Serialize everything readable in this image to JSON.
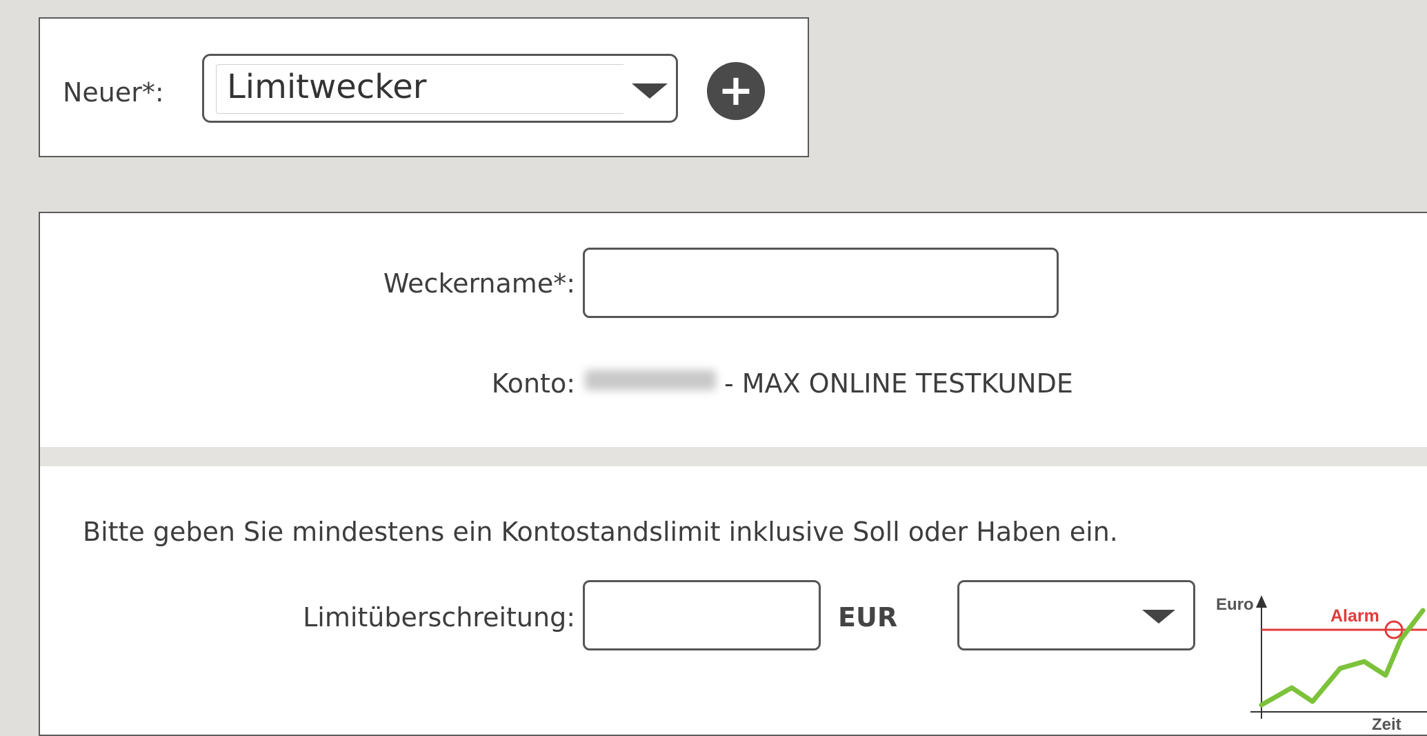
{
  "new_panel": {
    "label": "Neuer*:",
    "select_value": "Limitwecker",
    "add_icon": "plus-circle-icon"
  },
  "form": {
    "name_label": "Weckername*:",
    "name_value": "",
    "account_label": "Konto:",
    "account_value": "- MAX ONLINE TESTKUNDE",
    "instruction": "Bitte geben Sie mindestens ein Kontostandslimit inklusive Soll oder Haben ein.",
    "limit_label": "Limitüberschreitung:",
    "limit_value": "",
    "currency": "EUR",
    "type_select_value": ""
  },
  "illustration": {
    "y_label": "Euro",
    "x_label": "Zeit",
    "alarm_label": "Alarm",
    "colors": {
      "alarm": "#e23a3a",
      "line": "#7cc23a"
    }
  }
}
